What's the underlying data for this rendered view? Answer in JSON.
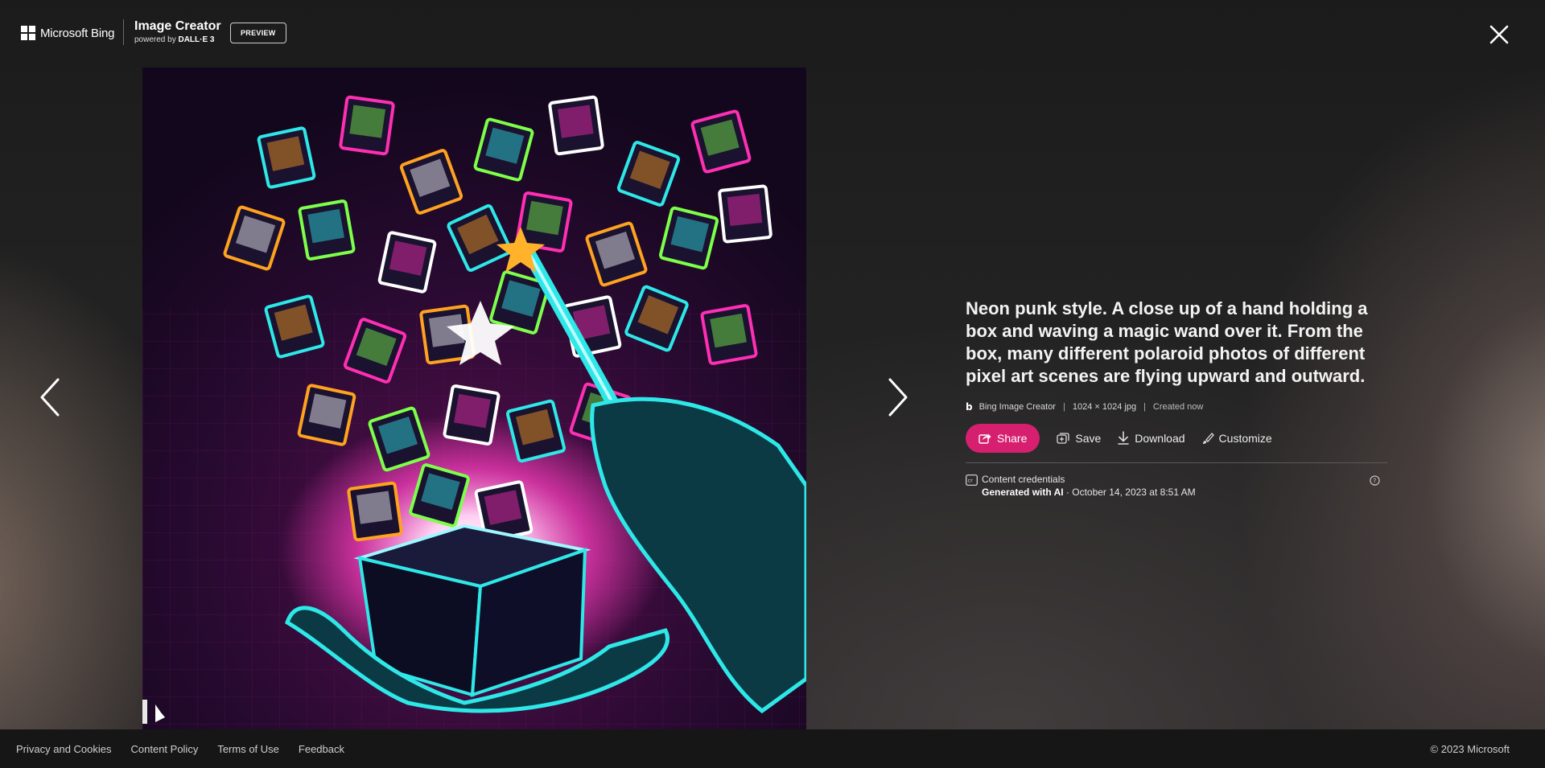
{
  "header": {
    "brand_name": "Microsoft Bing",
    "app_title": "Image Creator",
    "powered_by": "powered by ",
    "model": "DALL·E 3",
    "badge": "PREVIEW",
    "close_icon": "close-icon"
  },
  "image": {
    "alt": "Neon punk hand holding a glowing box with polaroid photos flying out",
    "watermark_icon": "bing-logo-icon"
  },
  "nav": {
    "prev_icon": "chevron-left-icon",
    "next_icon": "chevron-right-icon"
  },
  "details": {
    "prompt": "Neon punk style. A close up of a hand holding a box and waving a magic wand over it. From the box, many different polaroid photos of different pixel art scenes are flying upward and outward.",
    "source_icon": "b",
    "source": "Bing Image Creator",
    "size": "1024 × 1024 jpg",
    "created": "Created now",
    "sep": "|",
    "actions": {
      "share": "Share",
      "save": "Save",
      "download": "Download",
      "customize": "Customize"
    },
    "credentials": {
      "title": "Content credentials",
      "generated": "Generated with AI",
      "date": " · October 14, 2023 at 8:51 AM"
    }
  },
  "footer": {
    "links": [
      "Privacy and Cookies",
      "Content Policy",
      "Terms of Use",
      "Feedback"
    ],
    "copyright": "© 2023 Microsoft"
  },
  "colors": {
    "accent": "#d6206f",
    "neon_cyan": "#2ee8e8",
    "neon_pink": "#ff2fb3",
    "neon_orange": "#ffa21f"
  }
}
